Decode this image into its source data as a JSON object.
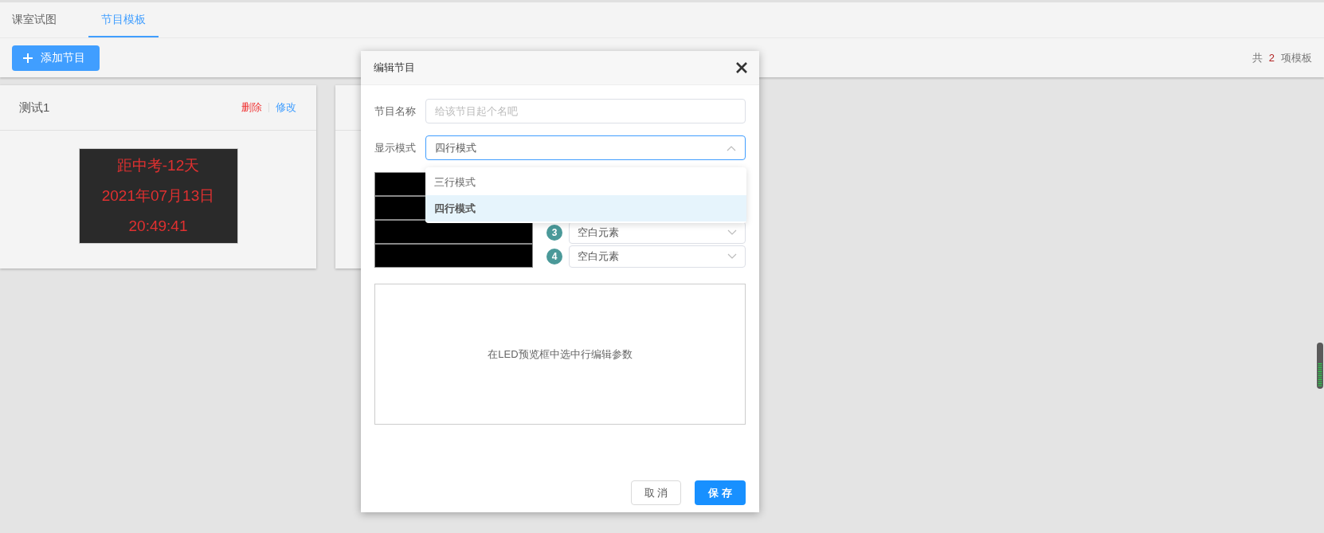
{
  "tabs": [
    {
      "label": "课室试图",
      "selected": false
    },
    {
      "label": "节目模板",
      "selected": true
    }
  ],
  "toolbar": {
    "add_button": "添加节目",
    "total": {
      "prefix": "共",
      "count": "2",
      "suffix": "项模板"
    }
  },
  "cards": [
    {
      "kind": "full",
      "title": "测试1",
      "actions": [
        {
          "label": "删除",
          "kind": "danger"
        },
        {
          "label": "修改",
          "kind": "link"
        }
      ],
      "led_lines": [
        "距中考-12天",
        "2021年07月13日",
        "20:49:41"
      ]
    },
    {
      "kind": "covered"
    }
  ],
  "dialog": {
    "title": "编辑节目",
    "name_field": {
      "label": "节目名称",
      "placeholder": "给该节目起个名吧"
    },
    "mode_field": {
      "label": "显示模式",
      "value": "四行模式",
      "expanded": true
    },
    "mode_options": [
      {
        "label": "三行模式",
        "selected": false
      },
      {
        "label": "四行模式",
        "selected": true
      }
    ],
    "element_rows": [
      {
        "number": "3",
        "value": "空白元素"
      },
      {
        "number": "4",
        "value": "空白元素"
      }
    ],
    "params_hint": "在LED预览框中选中行编辑参数",
    "buttons": [
      {
        "label": "取 消",
        "kind": "secondary"
      },
      {
        "label": "保 存",
        "kind": "primary"
      }
    ]
  }
}
